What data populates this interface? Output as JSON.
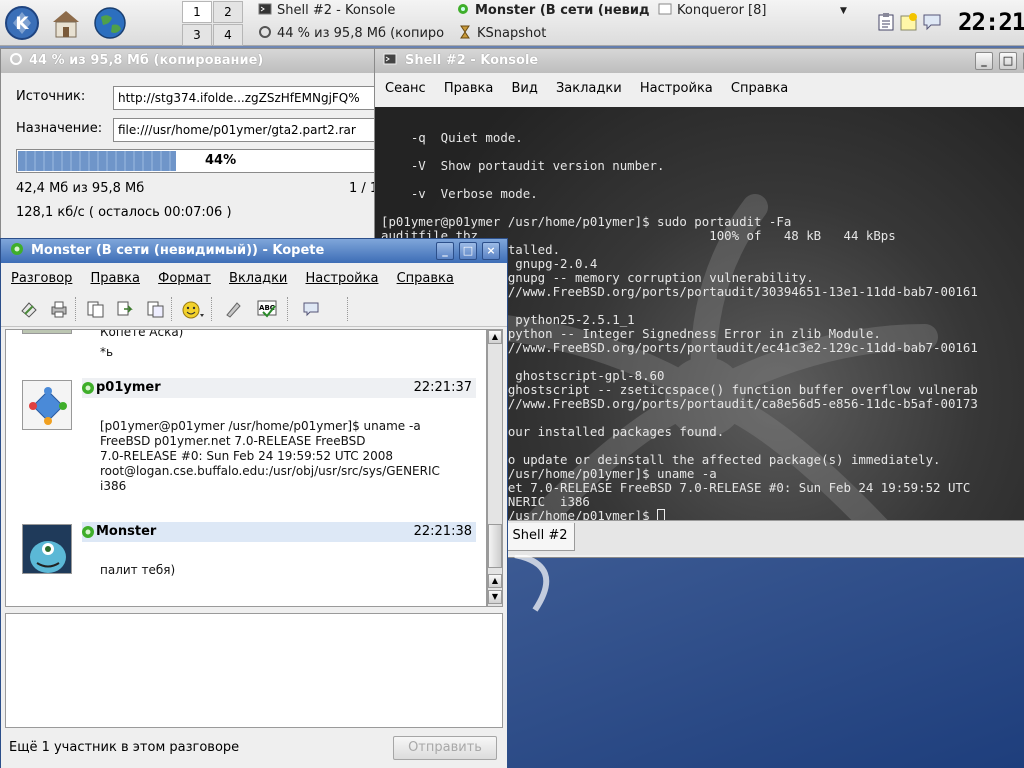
{
  "panel": {
    "pager": [
      "1",
      "2",
      "3",
      "4"
    ],
    "tasks": [
      {
        "label": "Shell #2 - Konsole",
        "icon": "terminal-icon"
      },
      {
        "label": "Monster (В сети (невид",
        "icon": "kopete-icon"
      },
      {
        "label": "Konqueror [8]",
        "icon": "konqueror-icon"
      },
      {
        "label": "44 % из 95,8 Мб  (копиро",
        "icon": "download-icon"
      },
      {
        "label": "KSnapshot",
        "icon": "ksnapshot-icon"
      }
    ],
    "clock": "22:21"
  },
  "download": {
    "title": "44 % из 95,8 Мб  (копирование)",
    "source_label": "Источник:",
    "source_value": "http://stg374.ifolde...zgZSzHfEMNgjFQ%",
    "dest_label": "Назначение:",
    "dest_value": "file:///usr/home/p01ymer/gta2.part2.rar",
    "progress": 0.44,
    "progress_text": "44%",
    "size_text": "42,4 Мб из 95,8 Мб",
    "count_text": "1 / 1",
    "speed_text": "128,1 кб/с ( осталось 00:07:06 )"
  },
  "konsole": {
    "title": "Shell #2 - Konsole",
    "menu": [
      "Сеанс",
      "Правка",
      "Вид",
      "Закладки",
      "Настройка",
      "Справка"
    ],
    "lines": [
      "",
      "    -q  Quiet mode.",
      "",
      "    -V  Show portaudit version number.",
      "",
      "    -v  Verbose mode.",
      "",
      "[p01ymer@p01ymer /usr/home/p01ymer]$ sudo portaudit -Fa",
      "auditfile.tbz                               100% of   48 kB   44 kBps",
      "                stalled.",
      "                : gnupg-2.0.4",
      "                 gnupg -- memory corruption vulnerability.",
      "                ://www.FreeBSD.org/ports/portaudit/30394651-13e1-11dd-bab7-00161",
      "",
      "                : python25-2.5.1_1",
      "                 python -- Integer Signedness Error in zlib Module.",
      "                ://www.FreeBSD.org/ports/portaudit/ec41c3e2-129c-11dd-bab7-00161",
      "",
      "                : ghostscript-gpl-8.60",
      "                 ghostscript -- zseticcspace() function buffer overflow vulnerab",
      "                ://www.FreeBSD.org/ports/portaudit/ca8e56d5-e856-11dc-b5af-00173",
      "",
      "                your installed packages found.",
      "",
      "                to update or deinstall the affected package(s) immediately.",
      "                 /usr/home/p01ymer]$ uname -a",
      "                net 7.0-RELEASE FreeBSD 7.0-RELEASE #0: Sun Feb 24 19:59:52 UTC",
      "                ENERIC  i386",
      "                 /usr/home/p01ymer]$ "
    ],
    "tab": "Shell #2"
  },
  "kopete": {
    "title": "Monster (В сети (невидимый)) - Kopete",
    "menu": [
      "Разговор",
      "Правка",
      "Формат",
      "Вкладки",
      "Настройка",
      "Справка"
    ],
    "prev_text": "Копете Аска)",
    "prev_text2": "*ь",
    "messages": [
      {
        "sender": "p01ymer",
        "time": "22:21:37",
        "body": "[p01ymer@p01ymer /usr/home/p01ymer]$ uname -a\nFreeBSD p01ymer.net 7.0-RELEASE FreeBSD\n7.0-RELEASE #0: Sun Feb 24 19:59:52 UTC 2008\nroot@logan.cse.buffalo.edu:/usr/obj/usr/src/sys/GENERIC\ni386"
      },
      {
        "sender": "Monster",
        "time": "22:21:38",
        "body": "палит тебя)"
      }
    ],
    "status": "Ещё 1 участник в этом разговоре",
    "send_label": "Отправить"
  }
}
